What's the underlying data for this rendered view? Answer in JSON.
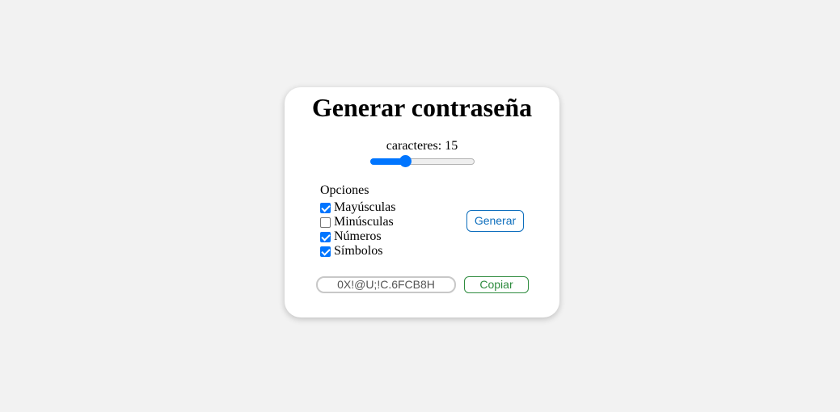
{
  "title": "Generar contraseña",
  "length": {
    "label": "caracteres:",
    "value": "15",
    "slider_fraction": 0.33,
    "accent_color": "#0075ff"
  },
  "options": {
    "title": "Opciones",
    "items": [
      {
        "label": "Mayúsculas",
        "checked": true
      },
      {
        "label": "Minúsculas",
        "checked": false
      },
      {
        "label": "Números",
        "checked": true
      },
      {
        "label": "Símbolos",
        "checked": true
      }
    ]
  },
  "generate_button": {
    "label": "Generar",
    "color": "#0d6ebd"
  },
  "password": {
    "value": "0X!@U;!C.6FCB8H"
  },
  "copy_button": {
    "label": "Copiar",
    "color": "#2e8b3e"
  }
}
